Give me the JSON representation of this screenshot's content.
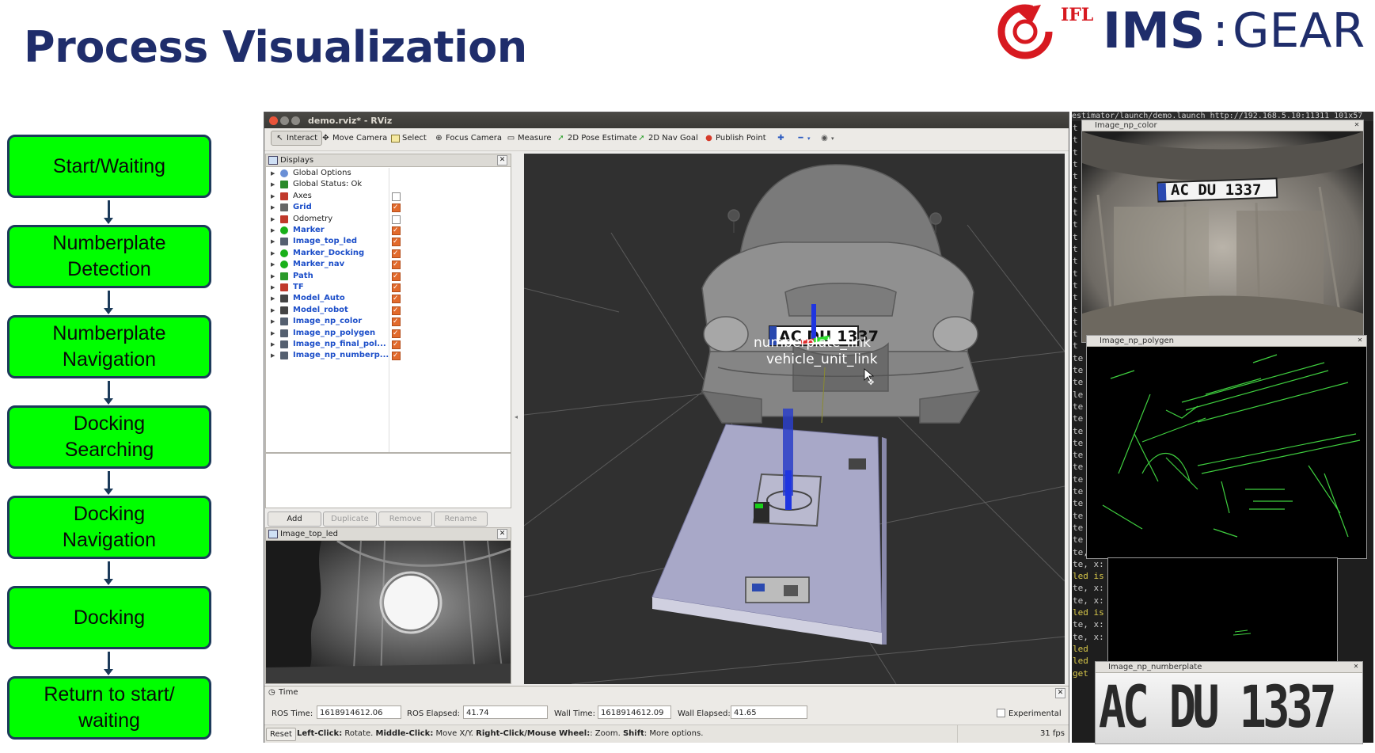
{
  "slide": {
    "title": "Process Visualization",
    "logo": {
      "brand_small": "IFL",
      "brand_main": "IMS",
      "brand_sep": ":",
      "brand_tail": "GEAR",
      "colors": {
        "red": "#d71920",
        "navy": "#1f2d6b"
      }
    }
  },
  "flowchart": {
    "steps": [
      {
        "line1": "Start/Waiting",
        "line2": ""
      },
      {
        "line1": "Numberplate",
        "line2": "Detection"
      },
      {
        "line1": "Numberplate",
        "line2": "Navigation"
      },
      {
        "line1": "Docking",
        "line2": "Searching"
      },
      {
        "line1": "Docking",
        "line2": "Navigation"
      },
      {
        "line1": "Docking",
        "line2": ""
      },
      {
        "line1": "Return to start/",
        "line2": "waiting"
      }
    ],
    "colors": {
      "fill": "#00ff00",
      "border": "#1c3a5a"
    }
  },
  "rviz": {
    "window_title": "demo.rviz* - RViz",
    "toolbar": {
      "interact": "Interact",
      "move_camera": "Move Camera",
      "select": "Select",
      "focus_camera": "Focus Camera",
      "measure": "Measure",
      "pose_estimate": "2D Pose Estimate",
      "nav_goal": "2D Nav Goal",
      "publish_point": "Publish Point"
    },
    "displays": {
      "title": "Displays",
      "items": [
        {
          "label": "Global Options",
          "blue": false,
          "checkbox": "none",
          "icon": "globe-icon",
          "color": "#6a8fd6"
        },
        {
          "label": "Global Status: Ok",
          "blue": false,
          "checkbox": "none",
          "icon": "check-icon",
          "color": "#2a8a2a"
        },
        {
          "label": "Axes",
          "blue": false,
          "checkbox": "off",
          "icon": "axes-icon",
          "color": "#c0392b"
        },
        {
          "label": "Grid",
          "blue": true,
          "checkbox": "on",
          "icon": "grid-icon",
          "color": "#666666"
        },
        {
          "label": "Odometry",
          "blue": false,
          "checkbox": "off",
          "icon": "odometry-icon",
          "color": "#c0392b"
        },
        {
          "label": "Marker",
          "blue": true,
          "checkbox": "on",
          "icon": "marker-icon",
          "color": "#19b019"
        },
        {
          "label": "Image_top_led",
          "blue": true,
          "checkbox": "on",
          "icon": "image-icon",
          "color": "#556070"
        },
        {
          "label": "Marker_Docking",
          "blue": true,
          "checkbox": "on",
          "icon": "marker-icon",
          "color": "#19b019"
        },
        {
          "label": "Marker_nav",
          "blue": true,
          "checkbox": "on",
          "icon": "marker-icon",
          "color": "#19b019"
        },
        {
          "label": "Path",
          "blue": true,
          "checkbox": "on",
          "icon": "path-icon",
          "color": "#2a9a2a"
        },
        {
          "label": "TF",
          "blue": true,
          "checkbox": "on",
          "icon": "tf-icon",
          "color": "#c0392b"
        },
        {
          "label": "Model_Auto",
          "blue": true,
          "checkbox": "on",
          "icon": "robot-model-icon",
          "color": "#444444"
        },
        {
          "label": "Model_robot",
          "blue": true,
          "checkbox": "on",
          "icon": "robot-model-icon",
          "color": "#444444"
        },
        {
          "label": "Image_np_color",
          "blue": true,
          "checkbox": "on",
          "icon": "image-icon",
          "color": "#556070"
        },
        {
          "label": "Image_np_polygen",
          "blue": true,
          "checkbox": "on",
          "icon": "image-icon",
          "color": "#556070"
        },
        {
          "label": "Image_np_final_pol...",
          "blue": true,
          "checkbox": "on",
          "icon": "image-icon",
          "color": "#556070"
        },
        {
          "label": "Image_np_numberp...",
          "blue": true,
          "checkbox": "on",
          "icon": "image-icon",
          "color": "#556070"
        }
      ],
      "buttons": {
        "add": "Add",
        "duplicate": "Duplicate",
        "remove": "Remove",
        "rename": "Rename"
      }
    },
    "image_top_led": {
      "title": "Image_top_led"
    },
    "viewport": {
      "plate_text": "AC DU 1337",
      "tf_label_1": "numberplate_link",
      "tf_label_2": "vehicle_unit_link"
    },
    "time": {
      "title": "Time",
      "ros_time_label": "ROS Time:",
      "ros_time": "1618914612.06",
      "ros_elapsed_label": "ROS Elapsed:",
      "ros_elapsed": "41.74",
      "wall_time_label": "Wall Time:",
      "wall_time": "1618914612.09",
      "wall_elapsed_label": "Wall Elapsed:",
      "wall_elapsed": "41.65",
      "experimental": "Experimental"
    },
    "status": {
      "reset": "Reset",
      "left_click": "Left-Click:",
      "left_click_desc": " Rotate. ",
      "middle_click": "Middle-Click:",
      "middle_click_desc": " Move X/Y. ",
      "right_click": "Right-Click/Mouse Wheel:",
      "right_click_desc": ": Zoom. ",
      "shift": "Shift",
      "shift_desc": ": More options.",
      "fps": "31 fps"
    }
  },
  "terminal": {
    "title_text": "estimator/launch/demo.launch http://192.168.5.10:11311 101x57",
    "lines": [
      "t",
      "t",
      "t",
      "t",
      "t",
      "t",
      "t",
      "t",
      "t",
      "t",
      "t",
      "t",
      "t",
      "t",
      "t",
      "t",
      "t",
      "t",
      "t",
      "te",
      "te",
      "te",
      "le",
      "te",
      "te",
      "te",
      "te",
      "te",
      "te",
      "te",
      "te",
      "te",
      "te",
      "te",
      "te",
      "te, x:",
      "te, x:",
      "led is",
      "te, x:",
      "te, x:",
      "led is",
      "te, x:",
      "te, x:",
      "led",
      "led",
      "get"
    ]
  },
  "image_windows": {
    "np_color": {
      "title": "Image_np_color",
      "plate": "AC DU 1337"
    },
    "np_polygen": {
      "title": "Image_np_polygen"
    },
    "np_numberplate": {
      "title": "Image_np_numberplate",
      "text": "AC DU 1337"
    }
  }
}
